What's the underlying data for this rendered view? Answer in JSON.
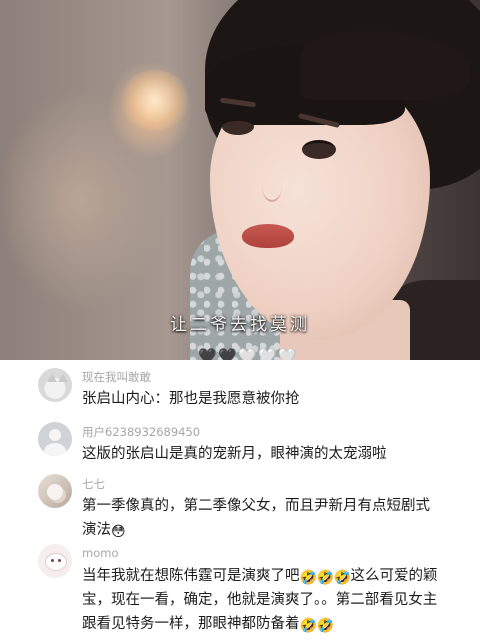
{
  "video": {
    "subtitle": "让二爷去找莫测",
    "hearts": [
      "🖤",
      "🖤",
      "🤍",
      "🤍",
      "🤍"
    ]
  },
  "comments": [
    {
      "user": "现在我叫敢敢",
      "text": "张启山内心：那也是我愿意被你抢",
      "avatar_icon": "cat-avatar-icon"
    },
    {
      "user": "用户6238932689450",
      "text": "这版的张启山是真的宠新月，眼神演的太宠溺啦",
      "avatar_icon": "default-user-avatar-icon"
    },
    {
      "user": "七七",
      "text_parts": [
        "第一季像真的，第二季像父女，而且尹新月有点短剧式演法"
      ],
      "emoji_end": "😳",
      "avatar_icon": "pet-avatar-icon"
    },
    {
      "user": "momo",
      "text_a": "当年我就在想陈伟霆可是演爽了吧",
      "emoji_a": [
        "🤣",
        "🤣",
        "🤣"
      ],
      "text_b": "这么可爱的颖宝，现在一看，确定，他就是演爽了。。第二部看见女主跟看见特务一样，那眼神都防备着",
      "emoji_b": [
        "🤣",
        "🤣"
      ],
      "avatar_icon": "cartoon-avatar-icon"
    }
  ]
}
